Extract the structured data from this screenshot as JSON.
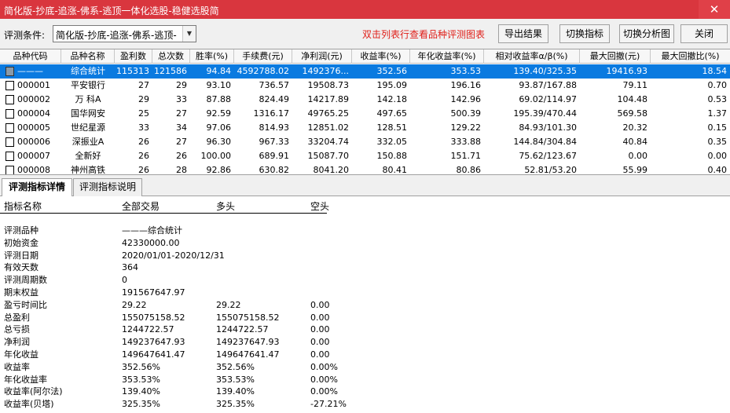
{
  "window": {
    "title": "简化版-抄底-追涨-佛系-逃顶一体化选股-稳健选股简",
    "close_label": "✕"
  },
  "toolbar": {
    "condition_label": "评测条件:",
    "condition_value": "简化版-抄底-追涨-佛系-逃顶-",
    "hint": "双击列表行查看品种评测图表",
    "buttons": {
      "export": "导出结果",
      "switch_indicator": "切换指标",
      "switch_chart": "切换分析图",
      "close": "关闭"
    }
  },
  "grid": {
    "columns": [
      "品种代码",
      "品种名称",
      "盈利数",
      "总次数",
      "胜率(%)",
      "手续费(元)",
      "净利润(元)",
      "收益率(%)",
      "年化收益率(%)",
      "相对收益率α/β(%)",
      "最大回撤(元)",
      "最大回撤比(%)"
    ],
    "rows": [
      {
        "code": "———",
        "name": "综合统计",
        "wins": "115313",
        "total": "121586",
        "win_rate": "94.84",
        "fee": "4592788.02",
        "net_profit": "1492376...",
        "return": "352.56",
        "annual_return": "353.53",
        "alpha_beta": "139.40/325.35",
        "max_dd": "19416.93",
        "max_dd_ratio": "18.54"
      },
      {
        "code": "000001",
        "name": "平安银行",
        "wins": "27",
        "total": "29",
        "win_rate": "93.10",
        "fee": "736.57",
        "net_profit": "19508.73",
        "return": "195.09",
        "annual_return": "196.16",
        "alpha_beta": "93.87/167.88",
        "max_dd": "79.11",
        "max_dd_ratio": "0.70"
      },
      {
        "code": "000002",
        "name": "万 科A",
        "wins": "29",
        "total": "33",
        "win_rate": "87.88",
        "fee": "824.49",
        "net_profit": "14217.89",
        "return": "142.18",
        "annual_return": "142.96",
        "alpha_beta": "69.02/114.97",
        "max_dd": "104.48",
        "max_dd_ratio": "0.53"
      },
      {
        "code": "000004",
        "name": "国华网安",
        "wins": "25",
        "total": "27",
        "win_rate": "92.59",
        "fee": "1316.17",
        "net_profit": "49765.25",
        "return": "497.65",
        "annual_return": "500.39",
        "alpha_beta": "195.39/470.44",
        "max_dd": "569.58",
        "max_dd_ratio": "1.37"
      },
      {
        "code": "000005",
        "name": "世纪星源",
        "wins": "33",
        "total": "34",
        "win_rate": "97.06",
        "fee": "814.93",
        "net_profit": "12851.02",
        "return": "128.51",
        "annual_return": "129.22",
        "alpha_beta": "84.93/101.30",
        "max_dd": "20.32",
        "max_dd_ratio": "0.15"
      },
      {
        "code": "000006",
        "name": "深振业A",
        "wins": "26",
        "total": "27",
        "win_rate": "96.30",
        "fee": "967.33",
        "net_profit": "33204.74",
        "return": "332.05",
        "annual_return": "333.88",
        "alpha_beta": "144.84/304.84",
        "max_dd": "40.84",
        "max_dd_ratio": "0.35"
      },
      {
        "code": "000007",
        "name": "全新好",
        "wins": "26",
        "total": "26",
        "win_rate": "100.00",
        "fee": "689.91",
        "net_profit": "15087.70",
        "return": "150.88",
        "annual_return": "151.71",
        "alpha_beta": "75.62/123.67",
        "max_dd": "0.00",
        "max_dd_ratio": "0.00"
      },
      {
        "code": "000008",
        "name": "神州高铁",
        "wins": "26",
        "total": "28",
        "win_rate": "92.86",
        "fee": "630.82",
        "net_profit": "8041.20",
        "return": "80.41",
        "annual_return": "80.86",
        "alpha_beta": "52.81/53.20",
        "max_dd": "55.99",
        "max_dd_ratio": "0.40"
      }
    ]
  },
  "tabs": {
    "details": "评测指标详情",
    "explain": "评测指标说明"
  },
  "detail": {
    "headers": [
      "指标名称",
      "全部交易",
      "多头",
      "空头"
    ],
    "rows": [
      {
        "name": "评测品种",
        "all": "———综合统计",
        "long": "",
        "short": ""
      },
      {
        "name": "初始资金",
        "all": "42330000.00",
        "long": "",
        "short": ""
      },
      {
        "name": "评测日期",
        "all": "2020/01/01-2020/12/31",
        "long": "",
        "short": ""
      },
      {
        "name": "有效天数",
        "all": "364",
        "long": "",
        "short": ""
      },
      {
        "name": "评测周期数",
        "all": "0",
        "long": "",
        "short": ""
      },
      {
        "name": "期末权益",
        "all": "191567647.97",
        "long": "",
        "short": ""
      },
      {
        "name": "盈亏时间比",
        "all": "29.22",
        "long": "29.22",
        "short": "0.00"
      },
      {
        "name": "总盈利",
        "all": "155075158.52",
        "long": "155075158.52",
        "short": "0.00"
      },
      {
        "name": "总亏损",
        "all": "1244722.57",
        "long": "1244722.57",
        "short": "0.00"
      },
      {
        "name": "净利润",
        "all": "149237647.93",
        "long": "149237647.93",
        "short": "0.00"
      },
      {
        "name": "年化收益",
        "all": "149647641.47",
        "long": "149647641.47",
        "short": "0.00"
      },
      {
        "name": "收益率",
        "all": "352.56%",
        "long": "352.56%",
        "short": "0.00%"
      },
      {
        "name": "年化收益率",
        "all": "353.53%",
        "long": "353.53%",
        "short": "0.00%"
      },
      {
        "name": "收益率(阿尔法)",
        "all": "139.40%",
        "long": "139.40%",
        "short": "0.00%"
      },
      {
        "name": "收益率(贝塔)",
        "all": "325.35%",
        "long": "325.35%",
        "short": "-27.21%"
      }
    ]
  }
}
